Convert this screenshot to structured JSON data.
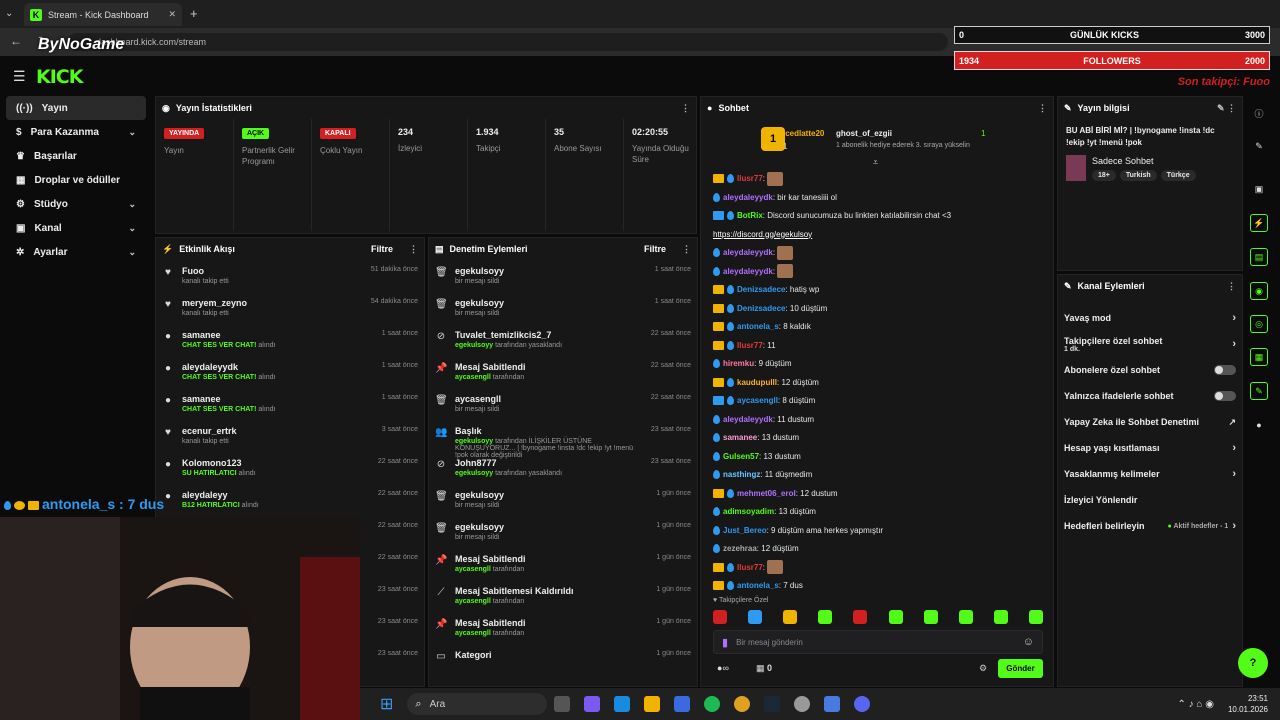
{
  "browser": {
    "tab_title": "Stream - Kick Dashboard",
    "url": "dashboard.kick.com/stream",
    "new_tab": "+"
  },
  "overlay": {
    "kicks_label": "GÜNLÜK KICKS",
    "kicks_current": "0",
    "kicks_goal": "3000",
    "followers_label": "FOLLOWERS",
    "followers_current": "1934",
    "followers_goal": "2000",
    "last_follower": "Son takipçi: Fuoo",
    "streamer_tag": "ByNoGame",
    "chat_overlay": "antonela_s : 7 dus"
  },
  "kick": {
    "logo": "KICK"
  },
  "sidebar": {
    "items": [
      {
        "label": "Yayın",
        "icon": "broadcast-icon"
      },
      {
        "label": "Para Kazanma",
        "icon": "money-icon"
      },
      {
        "label": "Başarılar",
        "icon": "trophy-icon"
      },
      {
        "label": "Droplar ve ödüller",
        "icon": "gift-icon"
      },
      {
        "label": "Stüdyo",
        "icon": "studio-icon"
      },
      {
        "label": "Kanal",
        "icon": "channel-icon"
      },
      {
        "label": "Ayarlar",
        "icon": "gear-icon"
      }
    ]
  },
  "stats": {
    "title": "Yayın İstatistikleri",
    "items": [
      {
        "badge": "YAYINDA",
        "badge_color": "#d21f1f",
        "label": "Yayın"
      },
      {
        "badge": "AÇIK",
        "badge_color": "#53fc18",
        "label": "Partnerlik Gelir Programı"
      },
      {
        "badge": "KAPALI",
        "badge_color": "#d21f1f",
        "label": "Çoklu Yayın"
      },
      {
        "value": "234",
        "label": "İzleyici"
      },
      {
        "value": "1.934",
        "label": "Takipçi"
      },
      {
        "value": "35",
        "label": "Abone Sayısı"
      },
      {
        "value": "02:20:55",
        "label": "Yayında Olduğu Süre"
      }
    ]
  },
  "activity": {
    "title": "Etkinlik Akışı",
    "filter": "Filtre",
    "items": [
      {
        "name": "Fuoo",
        "sub": "kanalı takip etti",
        "time": "51 dakika önce",
        "icon": "heart-icon"
      },
      {
        "name": "meryem_zeyno",
        "sub": "kanalı takip etti",
        "time": "54 dakika önce",
        "icon": "heart-icon"
      },
      {
        "name": "samanee",
        "hl": "CHAT SES VER CHAT!",
        "sub": " alındı",
        "time": "1 saat önce",
        "icon": "reward-icon"
      },
      {
        "name": "aleydaleyydk",
        "hl": "CHAT SES VER CHAT!",
        "sub": " alındı",
        "time": "1 saat önce",
        "icon": "reward-icon"
      },
      {
        "name": "samanee",
        "hl": "CHAT SES VER CHAT!",
        "sub": " alındı",
        "time": "1 saat önce",
        "icon": "reward-icon"
      },
      {
        "name": "ecenur_ertrk",
        "sub": "kanalı takip etti",
        "time": "3 saat önce",
        "icon": "heart-icon"
      },
      {
        "name": "Kolomono123",
        "hl": "SU HATIRLATICI",
        "sub": " alındı",
        "time": "22 saat önce",
        "icon": "reward-icon"
      },
      {
        "name": "aleydaleyy",
        "hl": "B12 HATIRLATICI",
        "sub": " alındı",
        "time": "22 saat önce",
        "icon": "reward-icon"
      },
      {
        "name": "",
        "sub": "",
        "time": "22 saat önce",
        "icon": ""
      },
      {
        "name": "",
        "sub": "",
        "time": "22 saat önce",
        "icon": ""
      },
      {
        "name": "",
        "sub": "",
        "time": "23 saat önce",
        "icon": ""
      },
      {
        "name": "",
        "sub": "",
        "time": "23 saat önce",
        "icon": ""
      },
      {
        "name": "",
        "sub": "",
        "time": "23 saat önce",
        "icon": ""
      }
    ]
  },
  "moderation": {
    "title": "Denetim Eylemleri",
    "filter": "Filtre",
    "items": [
      {
        "name": "egekulsoyy",
        "sub": "bir mesajı sildi",
        "time": "1 saat önce",
        "icon": "trash-icon"
      },
      {
        "name": "egekulsoyy",
        "sub": "bir mesajı sildi",
        "time": "1 saat önce",
        "icon": "trash-icon"
      },
      {
        "name": "Tuvalet_temizlikcis2_7",
        "hl": "egekulsoyy",
        "sub": " tarafından yasaklandı",
        "time": "22 saat önce",
        "icon": "ban-icon"
      },
      {
        "name": "Mesaj Sabitlendi",
        "hl": "aycasengll",
        "sub": " tarafından",
        "time": "22 saat önce",
        "icon": "pin-icon"
      },
      {
        "name": "aycasengll",
        "sub": "bir mesajı sildi",
        "time": "22 saat önce",
        "icon": "trash-icon"
      },
      {
        "name": "Başlık",
        "hl": "egekulsoyy",
        "sub": " tarafından İLİŞKİLER ÜSTÜNE KONUŞUYORUZ... | !bynogame !insta !dc !ekip !yt !menü !pok olarak değiştirildi",
        "time": "23 saat önce",
        "icon": "people-icon"
      },
      {
        "name": "John8777",
        "hl": "egekulsoyy",
        "sub": " tarafından yasaklandı",
        "time": "23 saat önce",
        "icon": "ban-icon"
      },
      {
        "name": "egekulsoyy",
        "sub": "bir mesajı sildi",
        "time": "1 gün önce",
        "icon": "trash-icon"
      },
      {
        "name": "egekulsoyy",
        "sub": "bir mesajı sildi",
        "time": "1 gün önce",
        "icon": "trash-icon"
      },
      {
        "name": "Mesaj Sabitlendi",
        "hl": "aycasengll",
        "sub": " tarafından",
        "time": "1 gün önce",
        "icon": "pin-icon"
      },
      {
        "name": "Mesaj Sabitlemesi Kaldırıldı",
        "hl": "aycasengll",
        "sub": " tarafından",
        "time": "1 gün önce",
        "icon": "unpin-icon"
      },
      {
        "name": "Mesaj Sabitlendi",
        "hl": "aycasengll",
        "sub": " tarafından",
        "time": "1 gün önce",
        "icon": "pin-icon"
      },
      {
        "name": "Kategori",
        "sub": "",
        "time": "1 gün önce",
        "icon": "category-icon"
      }
    ]
  },
  "chat": {
    "title": "Sohbet",
    "gifter": "Icedlatte20",
    "gifter_count": "1",
    "gift_recipient": "ghost_of_ezgii",
    "gift_rank": "1",
    "gift_desc": "1 abonelik hediye ederek 3. sıraya yükselin",
    "messages": [
      {
        "user": "Ilusr77",
        "color": "#e03a3a",
        "text": "",
        "emote": true,
        "crown": true
      },
      {
        "user": "aleydaleyydk",
        "color": "#b070ff",
        "text": "bir kar tanesiiii ol",
        "crown": false
      },
      {
        "user": "BotRix",
        "color": "#53fc18",
        "text": "Discord sunucumuza bu linkten katılabilirsin chat <3",
        "crown": false,
        "bot": true
      },
      {
        "user": "",
        "color": "#fff",
        "text": "https://discord.gg/egekulsoy",
        "link": true
      },
      {
        "user": "aleydaleyydk",
        "color": "#b070ff",
        "text": "",
        "emote": true
      },
      {
        "user": "aleydaleyydk",
        "color": "#b070ff",
        "text": "",
        "emote": true
      },
      {
        "user": "Denizsadece",
        "color": "#2e9bf0",
        "text": "hatiş wp",
        "crown": true
      },
      {
        "user": "Denizsadece",
        "color": "#2e9bf0",
        "text": "10 düştüm",
        "crown": true
      },
      {
        "user": "antonela_s",
        "color": "#2e9bf0",
        "text": "8 kaldık",
        "crown": true
      },
      {
        "user": "Ilusr77",
        "color": "#e03a3a",
        "text": "11",
        "crown": true
      },
      {
        "user": "hiremku",
        "color": "#ff7aa0",
        "text": "9 düştüm"
      },
      {
        "user": "kaudupulll",
        "color": "#ffb020",
        "text": "12 düştüm",
        "crown": true
      },
      {
        "user": "aycasengll",
        "color": "#2e9bf0",
        "text": "8 düştüm",
        "bot": true
      },
      {
        "user": "aleydaleyydk",
        "color": "#b070ff",
        "text": "11 dustum"
      },
      {
        "user": "samanee",
        "color": "#ff9ad0",
        "text": "13 dustum"
      },
      {
        "user": "Gulsen57",
        "color": "#53fc18",
        "text": "13 dustum"
      },
      {
        "user": "nasthingz",
        "color": "#6ac8ff",
        "text": "11 düşmedim"
      },
      {
        "user": "mehmet06_erol",
        "color": "#b070ff",
        "text": "12 dustum",
        "crown": true
      },
      {
        "user": "adimsoyadim",
        "color": "#53fc18",
        "text": "13 düştüm"
      },
      {
        "user": "Just_Bereo",
        "color": "#2e9bf0",
        "text": "9 düştüm ama herkes yapmıştır"
      },
      {
        "user": "zezehraa",
        "color": "#aaaaaa",
        "text": "12 düştüm"
      },
      {
        "user": "Ilusr77",
        "color": "#e03a3a",
        "text": "",
        "emote": true,
        "crown": true
      },
      {
        "user": "antonela_s",
        "color": "#2e9bf0",
        "text": "7 dus",
        "crown": true
      }
    ],
    "followers_only": "Takipçilere Özel",
    "input_placeholder": "Bir mesaj gönderin",
    "points": "∞",
    "count": "0",
    "send": "Gönder"
  },
  "streaminfo": {
    "title": "Yayın bilgisi",
    "stream_title": "BU ABİ BİRİ Mİ? | !bynogame !insta !dc !ekip !yt !menü !pok",
    "category": "Sadece Sohbet",
    "tags": [
      "18+",
      "Turkish",
      "Türkçe"
    ]
  },
  "channel_actions": {
    "title": "Kanal Eylemleri",
    "items": [
      {
        "label": "Yavaş mod",
        "type": "arrow"
      },
      {
        "label": "Takipçilere özel sohbet",
        "sub": "1 dk.",
        "type": "arrow"
      },
      {
        "label": "Abonelere özel sohbet",
        "type": "toggle"
      },
      {
        "label": "Yalnızca ifadelerle sohbet",
        "type": "toggle"
      },
      {
        "label": "Yapay Zeka ile Sohbet Denetimi",
        "type": "ext"
      },
      {
        "label": "Hesap yaşı kısıtlaması",
        "type": "arrow"
      },
      {
        "label": "Yasaklanmış kelimeler",
        "type": "arrow"
      },
      {
        "label": "İzleyici Yönlendir",
        "type": "none"
      },
      {
        "label": "Hedefleri belirleyin",
        "sub": "Aktif hedefler - 1",
        "type": "arrow"
      }
    ]
  },
  "taskbar": {
    "search": "Ara",
    "time": "23:51",
    "date": "10.01.2026"
  }
}
